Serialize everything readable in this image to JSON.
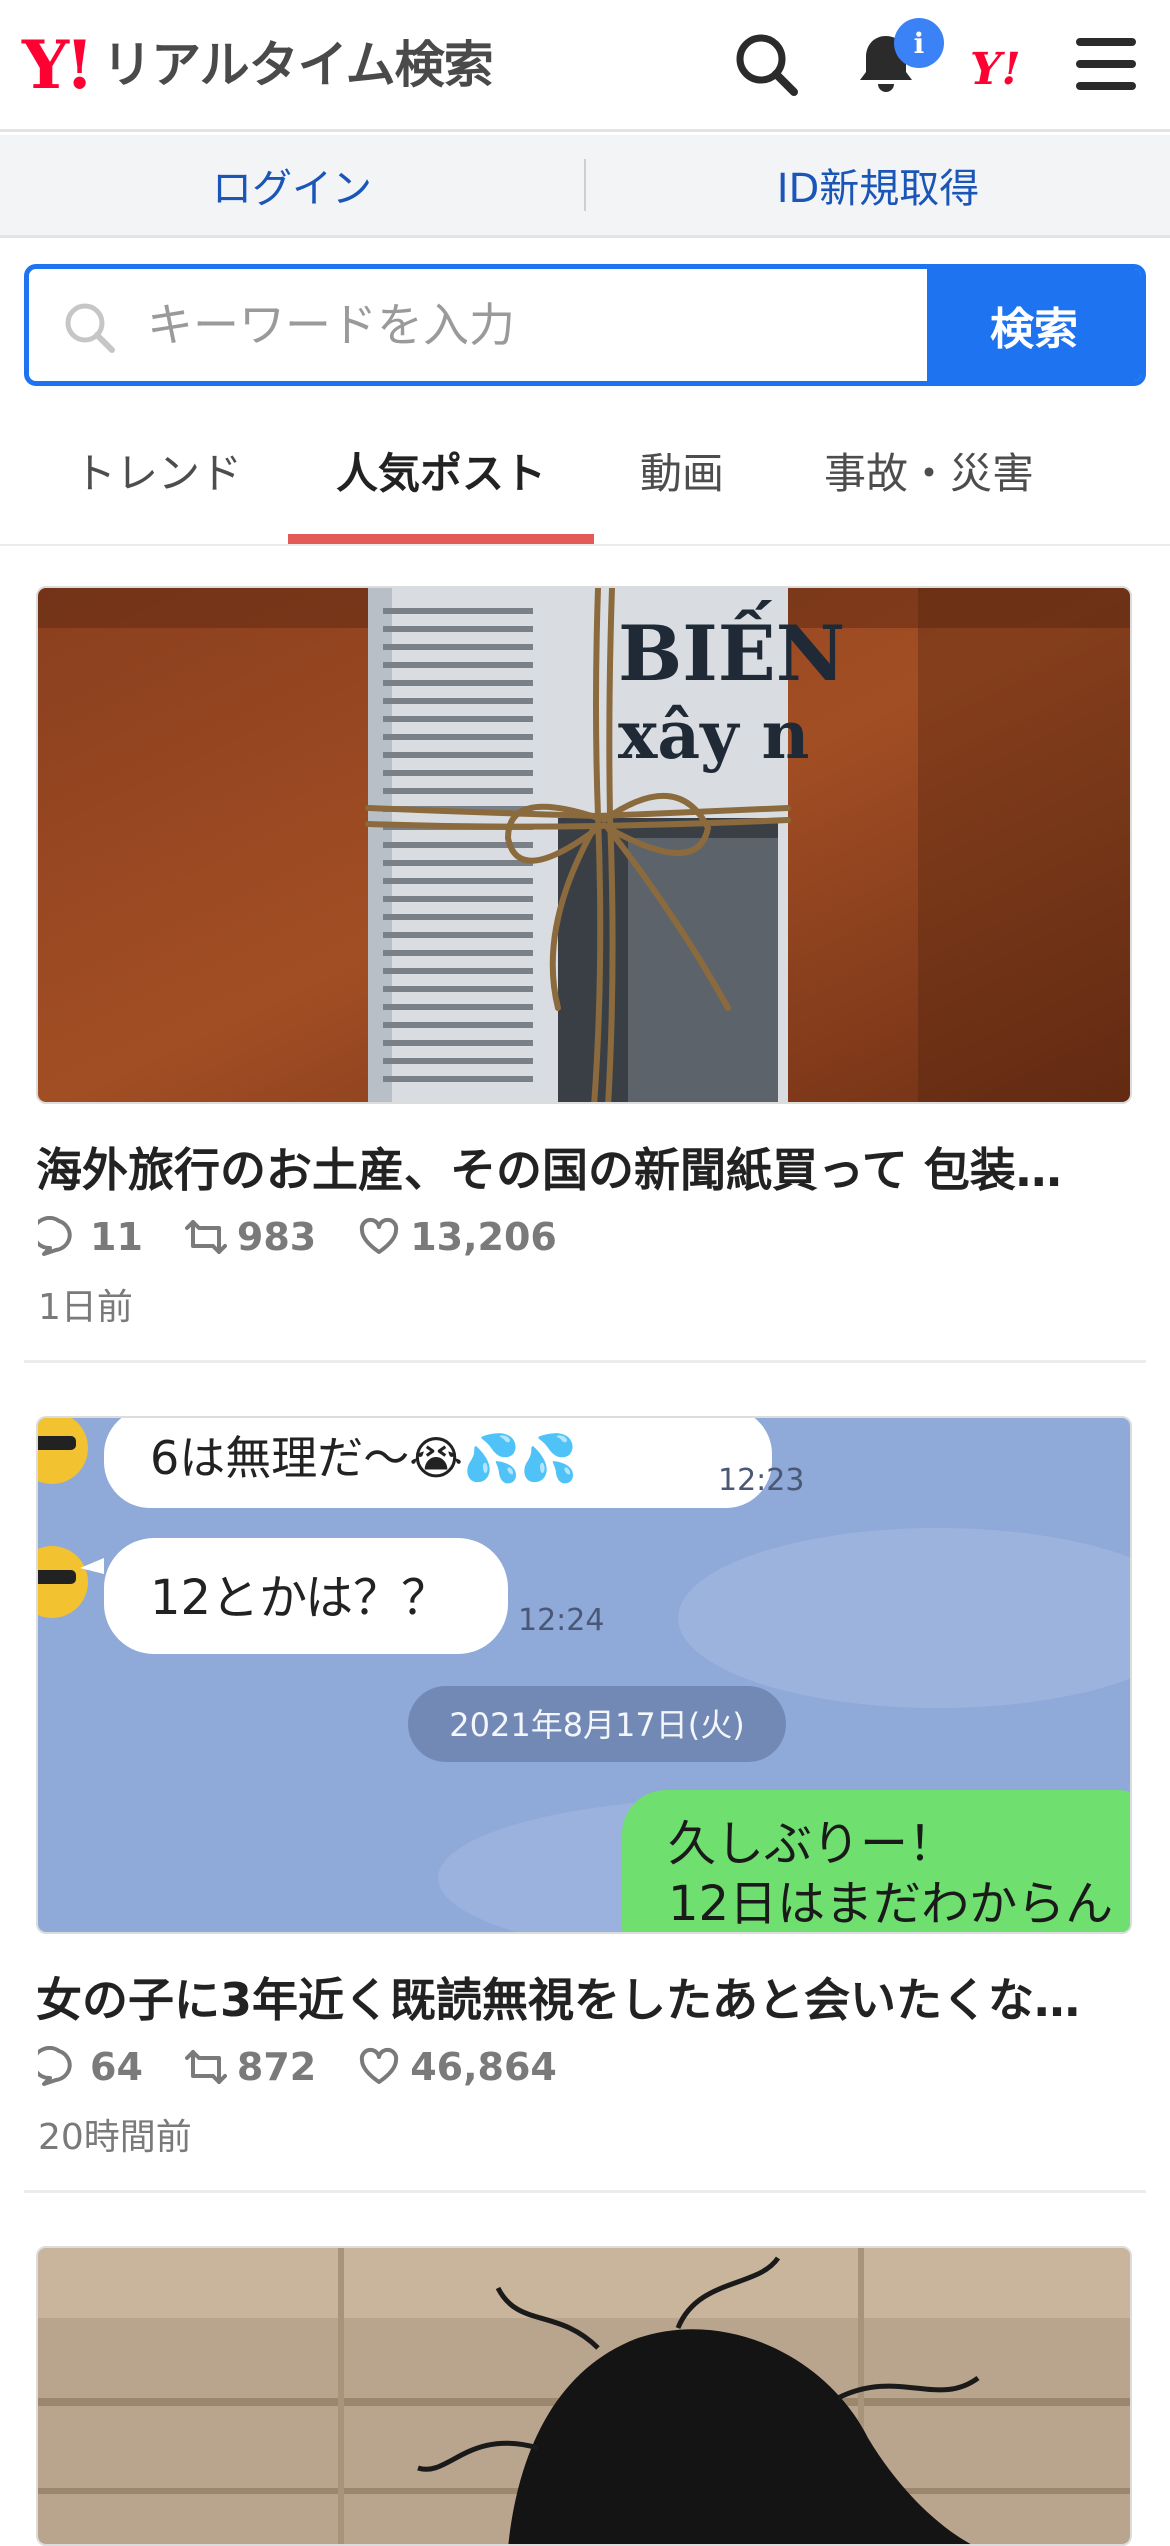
{
  "header": {
    "logo_mark": "Y!",
    "logo_text": "リアルタイム検索",
    "notification_badge": "i",
    "yj_mark": "Y!",
    "icons": [
      "search-icon",
      "bell-icon",
      "yahoo-japan-icon",
      "menu-icon"
    ]
  },
  "auth": {
    "login": "ログイン",
    "register": "ID新規取得"
  },
  "search": {
    "placeholder": "キーワードを入力",
    "button": "検索"
  },
  "tabs": [
    {
      "label": "トレンド",
      "active": false
    },
    {
      "label": "人気ポスト",
      "active": true
    },
    {
      "label": "動画",
      "active": false
    },
    {
      "label": "事故・災害",
      "active": false
    }
  ],
  "posts": [
    {
      "title": "海外旅行のお土産、その国の新聞紙買って 包装…",
      "replies": "11",
      "reposts": "983",
      "likes": "13,206",
      "time": "1日前",
      "image": {
        "headline_1": "BIẾN",
        "headline_2": "xây n"
      }
    },
    {
      "title": "女の子に3年近く既読無視をしたあと会いたくな…",
      "replies": "64",
      "reposts": "872",
      "likes": "46,864",
      "time": "20時間前",
      "image": {
        "msg_1": "6は無理だ〜😭💦💦",
        "msg_1_time": "12:23",
        "msg_2": "12とかは？？",
        "msg_2_time": "12:24",
        "date": "2021年8月17日(火)",
        "reply_line_1": "久しぶりー！",
        "reply_line_2": "12日はまだわからん"
      }
    },
    {
      "title": "",
      "image": {}
    }
  ],
  "colors": {
    "brand_red": "#ff0033",
    "accent_blue": "#1e73f0",
    "tab_underline": "#e35a57",
    "link_blue": "#1a55b8"
  }
}
